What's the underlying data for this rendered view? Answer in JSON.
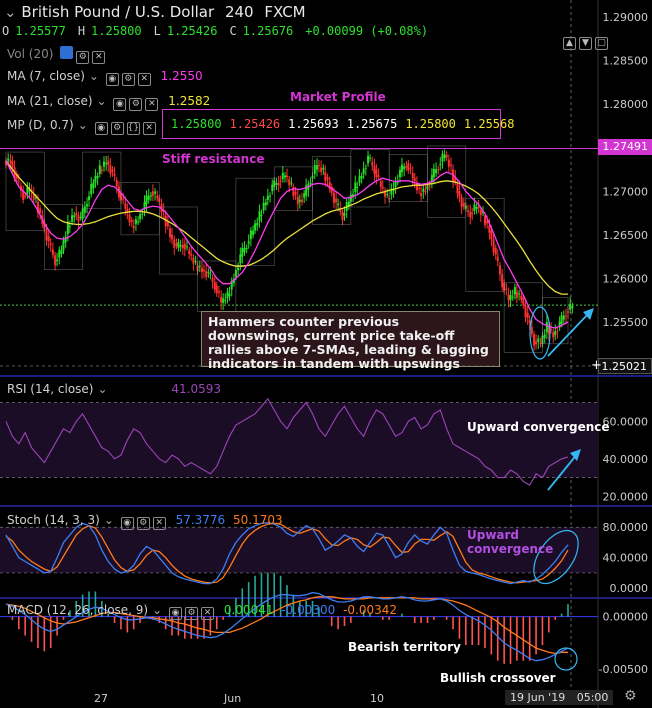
{
  "header": {
    "title": "British Pound / U.S. Dollar",
    "interval": "240",
    "source": "FXCM",
    "ohlc": {
      "o_label": "O",
      "o": "1.25577",
      "h_label": "H",
      "h": "1.25800",
      "l_label": "L",
      "l": "1.25426",
      "c_label": "C",
      "c": "1.25676",
      "change": "+0.00099 (+0.08%)"
    }
  },
  "indicators": {
    "vol": "Vol (20)",
    "ma7": {
      "label": "MA (7, close)",
      "value": "1.2550",
      "color": "#ff3af3"
    },
    "ma21": {
      "label": "MA (21, close)",
      "value": "1.2582",
      "color": "#f2e432"
    },
    "mp": {
      "label": "MP (D, 0.7)",
      "values": [
        "1.25800",
        "1.25426",
        "1.25693",
        "1.25675",
        "1.25800",
        "1.25568"
      ],
      "colors": [
        "#2de02d",
        "#ff4a4a",
        "#ffffff",
        "#ffffff",
        "#f2e432",
        "#f2e432"
      ]
    },
    "rsi": {
      "label": "RSI (14, close)",
      "value": "41.0593"
    },
    "stoch": {
      "label": "Stoch (14, 3, 3)",
      "k": "57.3776",
      "d": "50.1703"
    },
    "macd": {
      "label": "MACD (12, 26, close, 9)",
      "hist": "0.00041",
      "macd": "-0.00300",
      "signal": "-0.00342"
    }
  },
  "annotations": {
    "market_profile": "Market Profile",
    "stiff_resistance": "Stiff resistance",
    "note": "Hammers counter previous\ndownswings, current price take-off\nrallies above 7-SMAs, leading & lagging\nindicators in tandem with upswings",
    "rsi_note": "Upward convergence",
    "stoch_note": "Upward\nconvergence",
    "bearish": "Bearish territory",
    "bullish": "Bullish crossover"
  },
  "price_axis": {
    "ticks": [
      "1.29000",
      "1.28500",
      "1.28000",
      "1.27500",
      "1.27000",
      "1.26500",
      "1.26000",
      "1.25500"
    ],
    "resistance_tag": "1.27491",
    "current_tag": "1.25021"
  },
  "rsi_axis": {
    "ticks": [
      "60.0000",
      "40.0000",
      "20.0000"
    ]
  },
  "stoch_axis": {
    "ticks": [
      "80.0000",
      "40.0000",
      "0.0000"
    ]
  },
  "macd_axis": {
    "ticks": [
      "0.00000",
      "-0.00500"
    ]
  },
  "time_axis": {
    "ticks": [
      "27",
      "Jun",
      "10"
    ],
    "cursor_date": "19 Jun '19",
    "cursor_time": "05:00"
  },
  "colors": {
    "up": "#26e026",
    "down": "#ff3030",
    "ma7": "#ff3af3",
    "ma21": "#e8e03a",
    "rsi": "#9b45b8",
    "stoch_k": "#3d7ef2",
    "stoch_d": "#ff7a1a",
    "band": "#2a24c8",
    "resistance": "#d235d2",
    "arrow": "#35b8f2"
  },
  "chart_data": {
    "type": "candlestick",
    "price_range": [
      1.2485,
      1.2915
    ],
    "resistance_level": 1.27491,
    "current_level": 1.25693,
    "closes": [
      1.2735,
      1.2712,
      1.2695,
      1.2702,
      1.2688,
      1.2665,
      1.264,
      1.262,
      1.2632,
      1.266,
      1.2675,
      1.2668,
      1.269,
      1.271,
      1.2725,
      1.2735,
      1.272,
      1.2698,
      1.268,
      1.266,
      1.2668,
      1.2685,
      1.27,
      1.2692,
      1.2672,
      1.265,
      1.2635,
      1.264,
      1.2628,
      1.2615,
      1.261,
      1.2605,
      1.2592,
      1.2572,
      1.258,
      1.2602,
      1.2625,
      1.264,
      1.2655,
      1.2672,
      1.269,
      1.2705,
      1.2712,
      1.2718,
      1.2705,
      1.2688,
      1.2695,
      1.2715,
      1.273,
      1.2722,
      1.2705,
      1.2685,
      1.2672,
      1.2688,
      1.2705,
      1.272,
      1.2738,
      1.2725,
      1.2705,
      1.2692,
      1.2705,
      1.2722,
      1.2732,
      1.2715,
      1.2698,
      1.2702,
      1.2716,
      1.273,
      1.2742,
      1.2725,
      1.27,
      1.268,
      1.2675,
      1.2682,
      1.2672,
      1.2655,
      1.2625,
      1.2595,
      1.2575,
      1.2585,
      1.2578,
      1.2552,
      1.2528,
      1.2525,
      1.2545,
      1.2535,
      1.2548,
      1.2562,
      1.2568
    ],
    "ma7": [
      1.2735,
      1.272,
      1.2705,
      1.2698,
      1.269,
      1.2678,
      1.2663,
      1.2652,
      1.2646,
      1.2645,
      1.2648,
      1.2654,
      1.2662,
      1.2675,
      1.269,
      1.2702,
      1.2707,
      1.2705,
      1.2698,
      1.2689,
      1.268,
      1.2678,
      1.2681,
      1.2683,
      1.2682,
      1.2676,
      1.2667,
      1.2658,
      1.2648,
      1.2637,
      1.2628,
      1.262,
      1.2611,
      1.26,
      1.2594,
      1.2594,
      1.26,
      1.2607,
      1.2618,
      1.2632,
      1.2648,
      1.2664,
      1.2678,
      1.2692,
      1.27,
      1.2703,
      1.2702,
      1.2704,
      1.2708,
      1.2709,
      1.2708,
      1.2703,
      1.2698,
      1.2692,
      1.2693,
      1.2696,
      1.2701,
      1.2707,
      1.2712,
      1.2715,
      1.2713,
      1.2711,
      1.2712,
      1.2712,
      1.271,
      1.2708,
      1.2709,
      1.2712,
      1.2718,
      1.2722,
      1.2719,
      1.2711,
      1.27,
      1.2692,
      1.2685,
      1.2674,
      1.2658,
      1.264,
      1.2622,
      1.2609,
      1.2595,
      1.2581,
      1.2565,
      1.2553,
      1.2548,
      1.2545,
      1.2543,
      1.2546,
      1.255
    ],
    "ma21": [
      1.2735,
      1.2725,
      1.2716,
      1.2708,
      1.27,
      1.2692,
      1.2684,
      1.2676,
      1.2669,
      1.2665,
      1.2663,
      1.2662,
      1.2662,
      1.2663,
      1.2665,
      1.2668,
      1.2671,
      1.2673,
      1.2675,
      1.2676,
      1.2677,
      1.2677,
      1.2676,
      1.2674,
      1.2671,
      1.2667,
      1.2663,
      1.2658,
      1.2653,
      1.2647,
      1.2641,
      1.2635,
      1.2629,
      1.2623,
      1.2619,
      1.2616,
      1.2614,
      1.2614,
      1.2615,
      1.2618,
      1.2622,
      1.2627,
      1.2633,
      1.264,
      1.2646,
      1.2651,
      1.2656,
      1.2661,
      1.2666,
      1.267,
      1.2674,
      1.2677,
      1.2679,
      1.2681,
      1.2684,
      1.2687,
      1.2691,
      1.2694,
      1.2697,
      1.2699,
      1.2701,
      1.2703,
      1.2705,
      1.2706,
      1.2707,
      1.2707,
      1.2708,
      1.2709,
      1.2711,
      1.2712,
      1.2711,
      1.2709,
      1.2706,
      1.2702,
      1.2697,
      1.269,
      1.2682,
      1.2673,
      1.2663,
      1.2653,
      1.2643,
      1.2632,
      1.262,
      1.2609,
      1.2599,
      1.2591,
      1.2585,
      1.2582,
      1.2582
    ],
    "rsi": [
      60,
      52,
      48,
      54,
      46,
      42,
      38,
      44,
      50,
      56,
      54,
      60,
      64,
      58,
      52,
      46,
      44,
      40,
      42,
      50,
      56,
      54,
      48,
      44,
      40,
      38,
      42,
      40,
      36,
      38,
      36,
      34,
      32,
      36,
      44,
      52,
      58,
      60,
      62,
      64,
      68,
      72,
      66,
      60,
      56,
      62,
      66,
      70,
      64,
      56,
      52,
      58,
      64,
      68,
      62,
      56,
      52,
      60,
      66,
      64,
      58,
      52,
      54,
      60,
      62,
      56,
      58,
      64,
      66,
      56,
      48,
      46,
      44,
      42,
      40,
      36,
      34,
      30,
      30,
      34,
      32,
      28,
      26,
      32,
      30,
      36,
      38,
      40,
      41
    ],
    "stoch_k": [
      70,
      55,
      40,
      35,
      30,
      25,
      20,
      22,
      40,
      60,
      70,
      80,
      85,
      82,
      70,
      50,
      35,
      25,
      20,
      22,
      30,
      45,
      55,
      50,
      40,
      30,
      20,
      15,
      12,
      10,
      8,
      6,
      6,
      12,
      25,
      45,
      60,
      70,
      78,
      82,
      85,
      86,
      84,
      80,
      72,
      68,
      75,
      82,
      78,
      65,
      50,
      55,
      62,
      70,
      66,
      55,
      48,
      60,
      72,
      70,
      55,
      40,
      45,
      60,
      70,
      62,
      58,
      70,
      80,
      72,
      50,
      30,
      22,
      20,
      18,
      15,
      12,
      10,
      8,
      6,
      8,
      10,
      8,
      12,
      18,
      26,
      35,
      47,
      57
    ],
    "stoch_d": [
      68,
      62,
      50,
      42,
      35,
      30,
      25,
      22,
      28,
      42,
      56,
      70,
      78,
      82,
      79,
      67,
      52,
      37,
      27,
      22,
      24,
      32,
      43,
      50,
      48,
      40,
      30,
      22,
      16,
      12,
      10,
      8,
      7,
      8,
      14,
      27,
      43,
      58,
      69,
      76,
      81,
      84,
      85,
      84,
      79,
      74,
      72,
      75,
      78,
      75,
      65,
      57,
      56,
      62,
      66,
      64,
      57,
      54,
      60,
      67,
      66,
      56,
      47,
      48,
      58,
      64,
      64,
      63,
      69,
      74,
      68,
      51,
      34,
      24,
      20,
      18,
      15,
      12,
      10,
      8,
      7,
      8,
      9,
      10,
      12,
      18,
      26,
      36,
      50
    ],
    "macd": [
      0.0012,
      0.001,
      0.0006,
      0.0002,
      -0.0003,
      -0.0008,
      -0.0012,
      -0.0014,
      -0.0012,
      -0.0008,
      -0.0004,
      0.0,
      0.0004,
      0.0007,
      0.0009,
      0.0008,
      0.0005,
      0.0002,
      -0.0001,
      -0.0003,
      -0.0003,
      -0.0002,
      -0.0001,
      -0.0002,
      -0.0004,
      -0.0007,
      -0.001,
      -0.0012,
      -0.0014,
      -0.0016,
      -0.0018,
      -0.0019,
      -0.002,
      -0.0019,
      -0.0016,
      -0.0012,
      -0.0007,
      -0.0002,
      0.0003,
      0.0008,
      0.0012,
      0.0016,
      0.0019,
      0.0021,
      0.0021,
      0.002,
      0.002,
      0.0021,
      0.0023,
      0.0022,
      0.0019,
      0.0016,
      0.0014,
      0.0014,
      0.0015,
      0.0017,
      0.0019,
      0.0019,
      0.0018,
      0.0017,
      0.0017,
      0.0018,
      0.0019,
      0.0018,
      0.0016,
      0.0015,
      0.0015,
      0.0016,
      0.0017,
      0.0015,
      0.0011,
      0.0006,
      0.0002,
      -0.0001,
      -0.0004,
      -0.0008,
      -0.0013,
      -0.0019,
      -0.0025,
      -0.0029,
      -0.0032,
      -0.0036,
      -0.004,
      -0.0042,
      -0.0041,
      -0.0039,
      -0.0036,
      -0.0033,
      -0.003
    ],
    "macd_signal": [
      0.0012,
      0.0011,
      0.001,
      0.0008,
      0.0005,
      0.0002,
      -0.0001,
      -0.0004,
      -0.0006,
      -0.0007,
      -0.0006,
      -0.0005,
      -0.0003,
      -0.0001,
      0.0001,
      0.0003,
      0.0004,
      0.0004,
      0.0003,
      0.0002,
      0.0001,
      0.0,
      -0.0001,
      -0.0001,
      -0.0002,
      -0.0003,
      -0.0004,
      -0.0006,
      -0.0007,
      -0.0009,
      -0.0011,
      -0.0012,
      -0.0014,
      -0.0015,
      -0.0015,
      -0.0015,
      -0.0013,
      -0.0011,
      -0.0008,
      -0.0005,
      -0.0002,
      0.0002,
      0.0005,
      0.0008,
      0.0011,
      0.0013,
      0.0015,
      0.0016,
      0.0018,
      0.0019,
      0.0019,
      0.0019,
      0.0018,
      0.0017,
      0.0017,
      0.0017,
      0.0017,
      0.0018,
      0.0018,
      0.0018,
      0.0018,
      0.0018,
      0.0018,
      0.0018,
      0.0018,
      0.0017,
      0.0017,
      0.0017,
      0.0017,
      0.0016,
      0.0015,
      0.0013,
      0.0011,
      0.0008,
      0.0005,
      0.0002,
      -0.0001,
      -0.0005,
      -0.001,
      -0.0014,
      -0.0018,
      -0.0022,
      -0.0026,
      -0.003,
      -0.0032,
      -0.0034,
      -0.0035,
      -0.0034,
      -0.0034
    ],
    "rsi_range": [
      17,
      82
    ],
    "stoch_range": [
      -5,
      100
    ],
    "macd_range": [
      -0.0068,
      0.0014
    ]
  }
}
